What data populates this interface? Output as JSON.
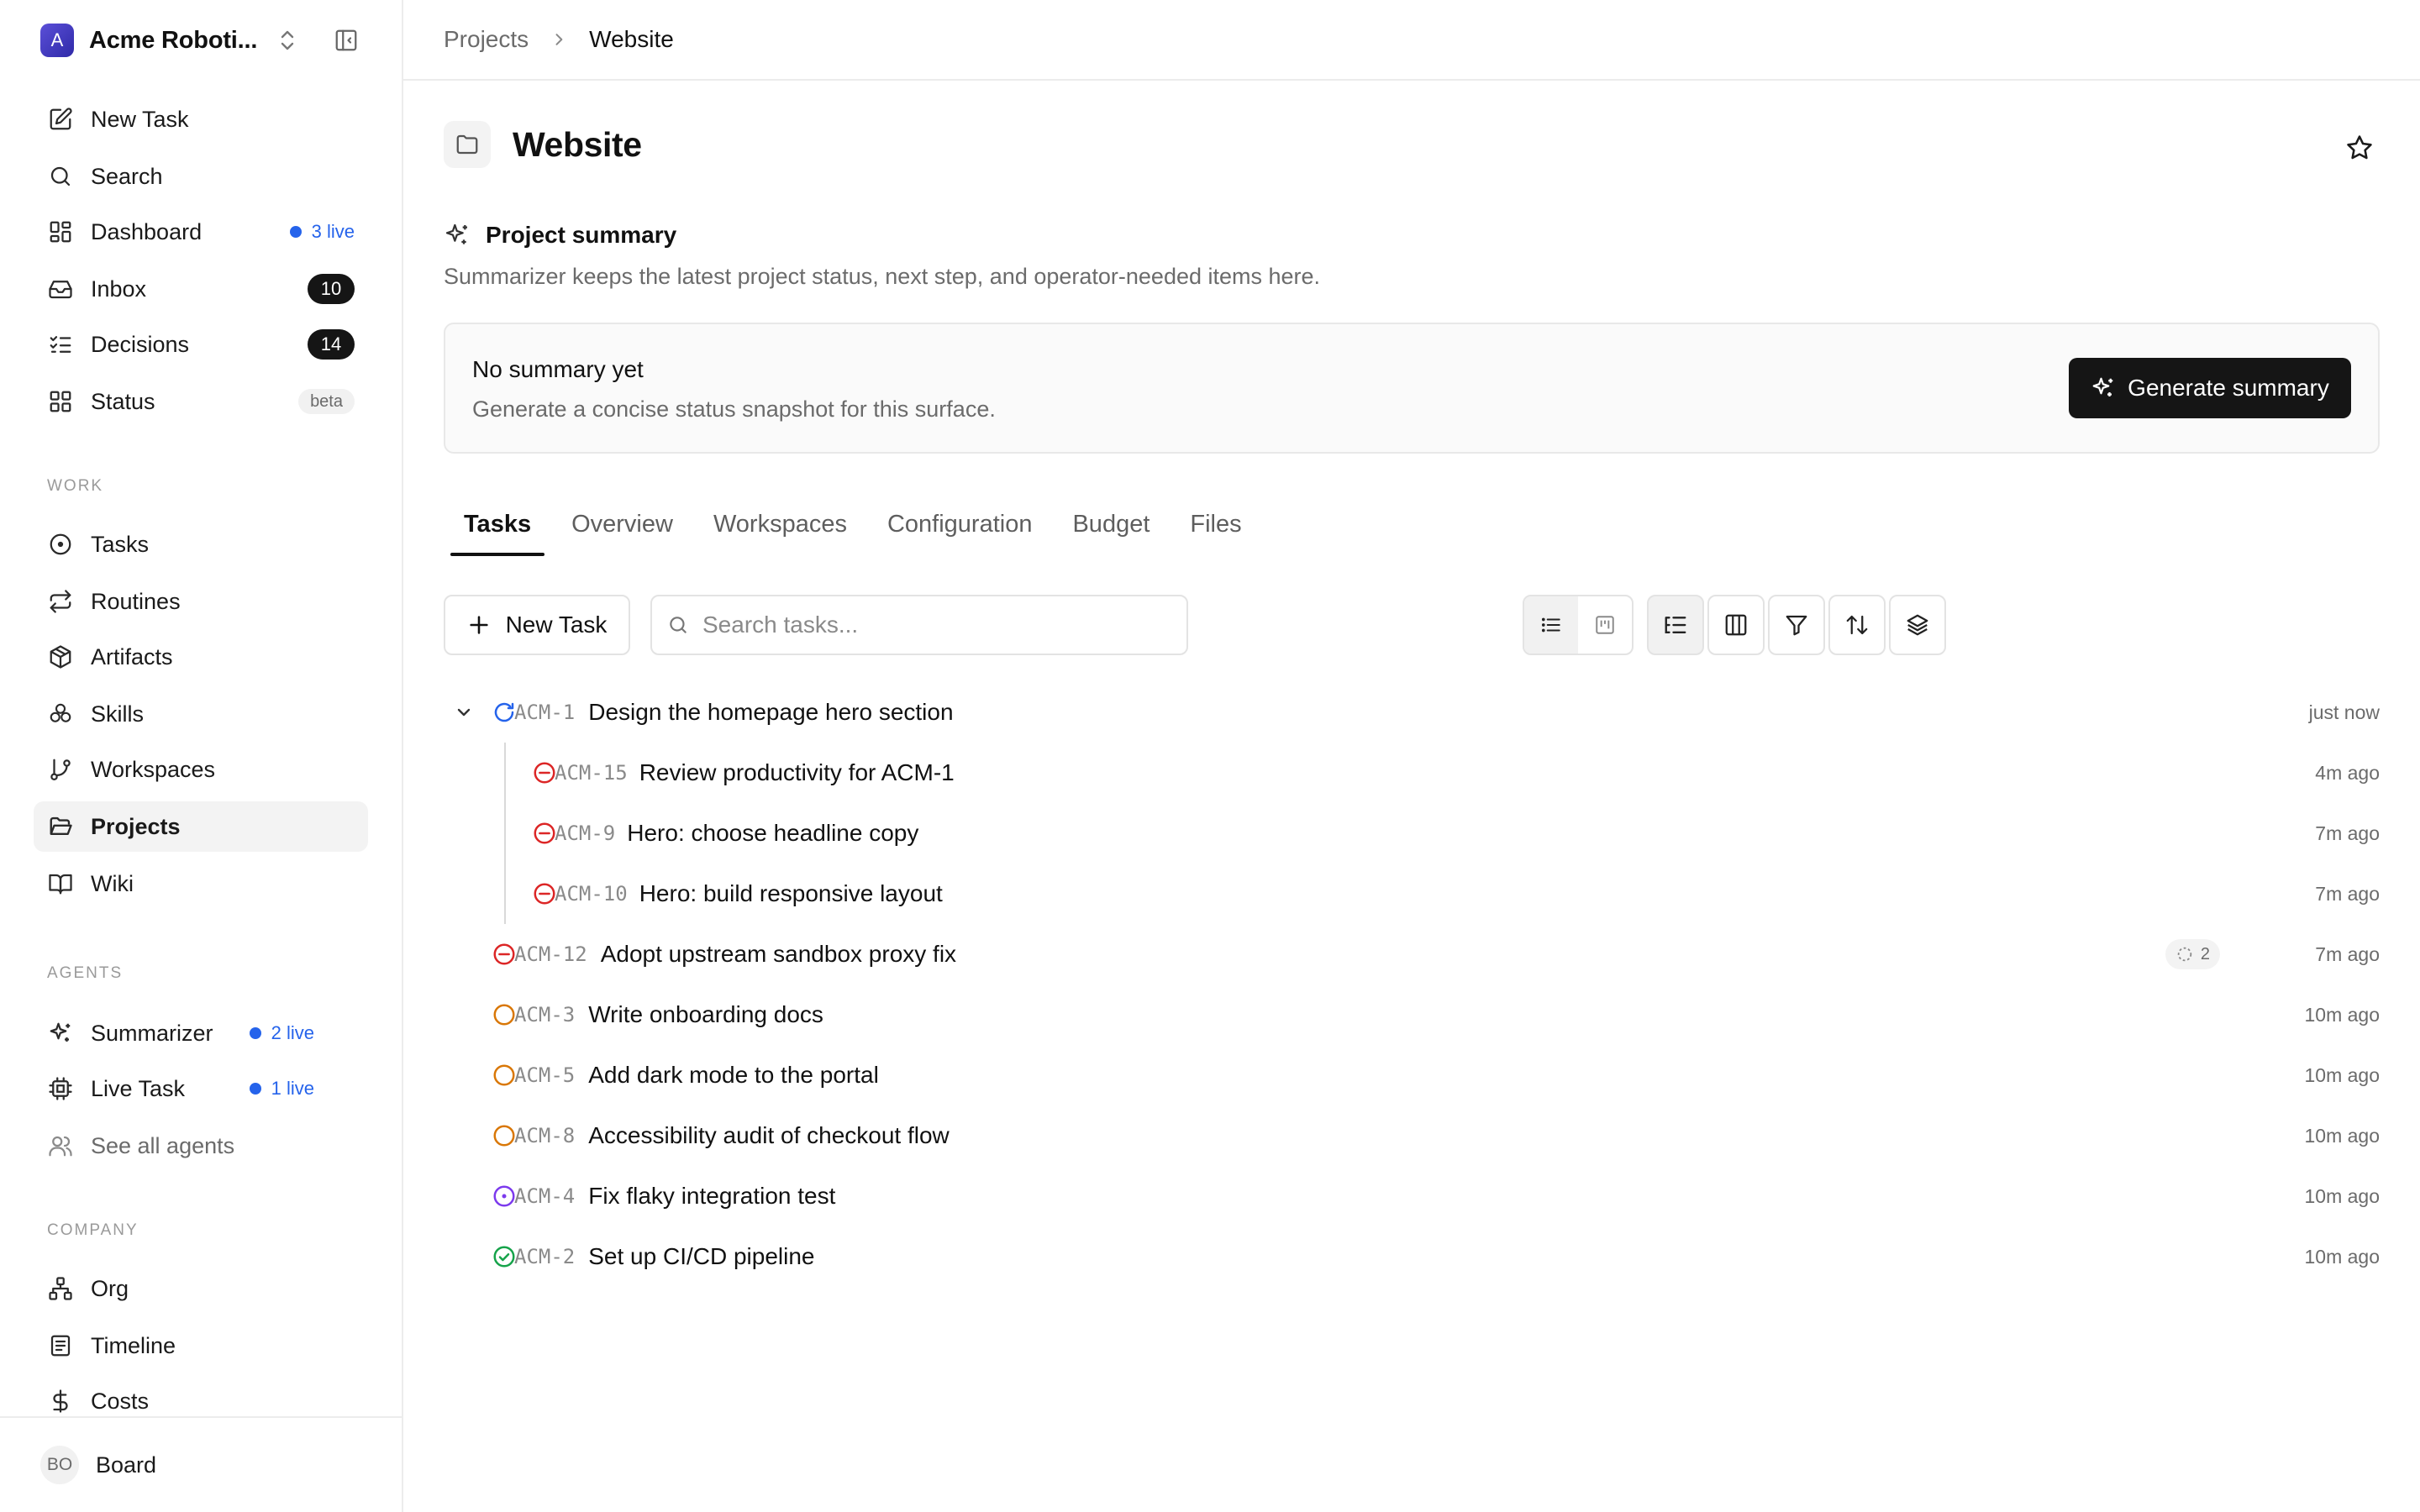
{
  "workspace": {
    "name": "Acme Roboti...",
    "avatar_letter": "A"
  },
  "nav_top": [
    {
      "label": "New Task",
      "icon": "edit-icon"
    },
    {
      "label": "Search",
      "icon": "search-icon"
    },
    {
      "label": "Dashboard",
      "icon": "dashboard-icon",
      "live": "3 live"
    },
    {
      "label": "Inbox",
      "icon": "inbox-icon",
      "count": "10"
    },
    {
      "label": "Decisions",
      "icon": "list-checks-icon",
      "count": "14"
    },
    {
      "label": "Status",
      "icon": "grid-icon",
      "badge": "beta"
    }
  ],
  "sections": {
    "work": "WORK",
    "agents": "AGENTS",
    "company": "COMPANY"
  },
  "nav_work": [
    {
      "label": "Tasks",
      "icon": "circle-dot-icon"
    },
    {
      "label": "Routines",
      "icon": "repeat-icon"
    },
    {
      "label": "Artifacts",
      "icon": "package-icon"
    },
    {
      "label": "Skills",
      "icon": "boxes-icon"
    },
    {
      "label": "Workspaces",
      "icon": "git-branch-icon"
    },
    {
      "label": "Projects",
      "icon": "folder-open-icon",
      "active": true
    },
    {
      "label": "Wiki",
      "icon": "book-icon"
    }
  ],
  "nav_agents": [
    {
      "label": "Summarizer",
      "icon": "sparkles-icon",
      "live": "2 live"
    },
    {
      "label": "Live Task",
      "icon": "cpu-icon",
      "live": "1 live"
    },
    {
      "label": "See all agents",
      "icon": "users-icon"
    }
  ],
  "nav_company": [
    {
      "label": "Org",
      "icon": "org-chart-icon"
    },
    {
      "label": "Timeline",
      "icon": "timeline-icon"
    },
    {
      "label": "Costs",
      "icon": "dollar-icon"
    }
  ],
  "user": {
    "initials": "BO",
    "name": "Board"
  },
  "breadcrumb": {
    "parent": "Projects",
    "current": "Website"
  },
  "page": {
    "title": "Website"
  },
  "summary": {
    "title": "Project summary",
    "description": "Summarizer keeps the latest project status, next step, and operator-needed items here.",
    "card_title": "No summary yet",
    "card_description": "Generate a concise status snapshot for this surface.",
    "button": "Generate summary"
  },
  "tabs": [
    "Tasks",
    "Overview",
    "Workspaces",
    "Configuration",
    "Budget",
    "Files"
  ],
  "active_tab": "Tasks",
  "toolbar": {
    "new_task": "New Task",
    "search_placeholder": "Search tasks..."
  },
  "tasks": [
    {
      "id": "ACM-1",
      "title": "Design the homepage hero section",
      "time": "just now",
      "status": "in-progress",
      "expanded": true
    },
    {
      "id": "ACM-15",
      "title": "Review productivity for ACM-1",
      "time": "4m ago",
      "status": "blocked",
      "child": true
    },
    {
      "id": "ACM-9",
      "title": "Hero: choose headline copy",
      "time": "7m ago",
      "status": "blocked",
      "child": true
    },
    {
      "id": "ACM-10",
      "title": "Hero: build responsive layout",
      "time": "7m ago",
      "status": "blocked",
      "child": true
    },
    {
      "id": "ACM-12",
      "title": "Adopt upstream sandbox proxy fix",
      "time": "7m ago",
      "status": "blocked",
      "subtasks": "2"
    },
    {
      "id": "ACM-3",
      "title": "Write onboarding docs",
      "time": "10m ago",
      "status": "todo"
    },
    {
      "id": "ACM-5",
      "title": "Add dark mode to the portal",
      "time": "10m ago",
      "status": "todo"
    },
    {
      "id": "ACM-8",
      "title": "Accessibility audit of checkout flow",
      "time": "10m ago",
      "status": "todo"
    },
    {
      "id": "ACM-4",
      "title": "Fix flaky integration test",
      "time": "10m ago",
      "status": "in-review"
    },
    {
      "id": "ACM-2",
      "title": "Set up CI/CD pipeline",
      "time": "10m ago",
      "status": "done"
    }
  ],
  "colors": {
    "live": "#2563eb",
    "blocked": "#dc2626",
    "todo": "#d97706",
    "in_review": "#7c3aed",
    "done": "#16a34a",
    "in_progress": "#2563eb",
    "dark_button": "#151515"
  }
}
